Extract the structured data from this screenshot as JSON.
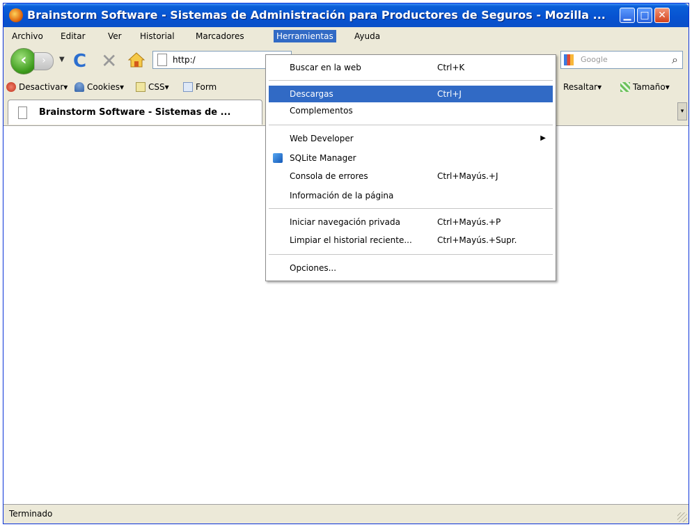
{
  "window": {
    "title": "Brainstorm Software - Sistemas de Administración para Productores de Seguros - Mozilla ..."
  },
  "menubar": {
    "items": [
      "Archivo",
      "Editar",
      "Ver",
      "Historial",
      "Marcadores",
      "Herramientas",
      "Ayuda"
    ],
    "active": "Herramientas"
  },
  "toolbar": {
    "url": "http:/",
    "search_placeholder": "Google"
  },
  "bookmarks": [
    "Desactivar",
    "Cookies",
    "CSS",
    "Form",
    "Resaltar",
    "Tamaño"
  ],
  "tab": {
    "title": "Brainstorm Software - Sistemas de ..."
  },
  "tools_menu": {
    "items": [
      {
        "label": "Buscar en la web",
        "shortcut": "Ctrl+K"
      },
      {
        "label": "Descargas",
        "shortcut": "Ctrl+J",
        "highlighted": true
      },
      {
        "label": "Complementos",
        "shortcut": ""
      },
      {
        "label": "Web Developer",
        "shortcut": "",
        "submenu": true
      },
      {
        "label": "SQLite Manager",
        "shortcut": ""
      },
      {
        "label": "Consola de errores",
        "shortcut": "Ctrl+Mayús.+J"
      },
      {
        "label": "Información de la página",
        "shortcut": ""
      },
      {
        "label": "Iniciar navegación privada",
        "shortcut": "Ctrl+Mayús.+P"
      },
      {
        "label": "Limpiar el historial reciente...",
        "shortcut": "Ctrl+Mayús.+Supr."
      },
      {
        "label": "Opciones...",
        "shortcut": ""
      }
    ]
  },
  "status": {
    "text": "Terminado"
  },
  "colors": {
    "titlebar": "#0752d0",
    "highlight": "#316ac5",
    "chrome": "#ece9d8"
  }
}
